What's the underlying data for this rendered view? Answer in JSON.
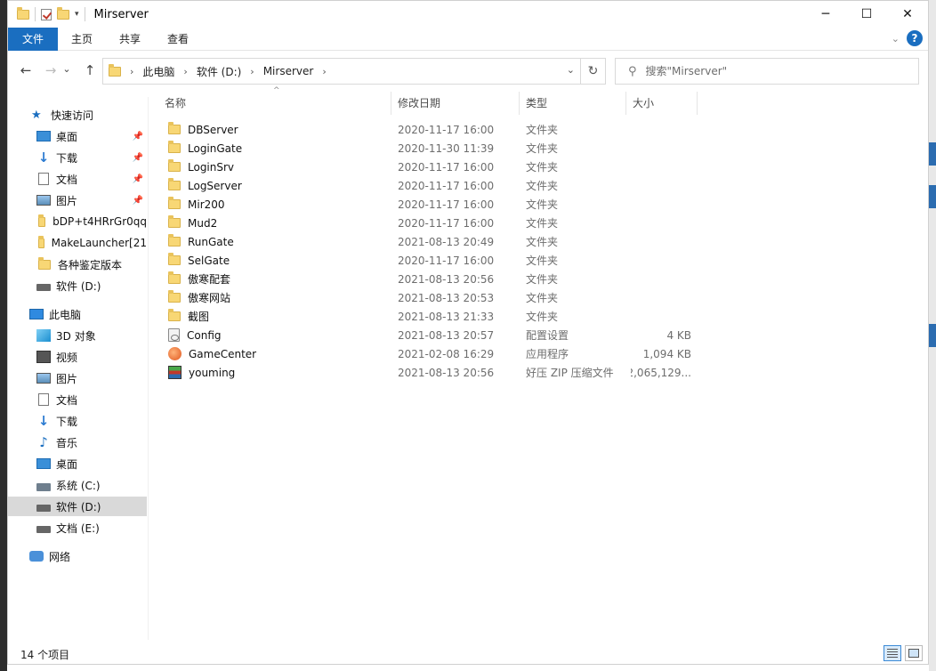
{
  "window": {
    "title": "Mirserver",
    "controls": {
      "minimize": "─",
      "maximize": "☐",
      "close": "✕"
    }
  },
  "ribbon": {
    "tabs": [
      "文件",
      "主页",
      "共享",
      "查看"
    ],
    "help": "?"
  },
  "nav": {
    "back": "←",
    "forward": "→",
    "recent": "⌄",
    "up": "↑",
    "breadcrumb": [
      "此电脑",
      "软件 (D:)",
      "Mirserver"
    ],
    "refresh": "↻",
    "search_placeholder": "搜索\"Mirserver\""
  },
  "sidebar": {
    "items": [
      {
        "label": "快速访问",
        "icon": "star-icon"
      },
      {
        "label": "桌面",
        "icon": "desktop-icon",
        "pinned": true
      },
      {
        "label": "下载",
        "icon": "download-icon",
        "pinned": true
      },
      {
        "label": "文档",
        "icon": "document-icon",
        "pinned": true
      },
      {
        "label": "图片",
        "icon": "picture-icon",
        "pinned": true
      },
      {
        "label": "bDP+t4HRrGr0qq",
        "icon": "folder-icon"
      },
      {
        "label": "MakeLauncher[21",
        "icon": "folder-icon"
      },
      {
        "label": "各种鉴定版本",
        "icon": "folder-icon"
      },
      {
        "label": "软件 (D:)",
        "icon": "drive-icon"
      },
      {
        "label": "此电脑",
        "icon": "computer-icon"
      },
      {
        "label": "3D 对象",
        "icon": "3d-objects-icon"
      },
      {
        "label": "视频",
        "icon": "video-icon"
      },
      {
        "label": "图片",
        "icon": "picture-icon"
      },
      {
        "label": "文档",
        "icon": "document-icon"
      },
      {
        "label": "下载",
        "icon": "download-icon"
      },
      {
        "label": "音乐",
        "icon": "music-icon"
      },
      {
        "label": "桌面",
        "icon": "desktop-icon"
      },
      {
        "label": "系统 (C:)",
        "icon": "system-drive-icon"
      },
      {
        "label": "软件 (D:)",
        "icon": "drive-icon",
        "selected": true
      },
      {
        "label": "文档 (E:)",
        "icon": "drive-icon"
      },
      {
        "label": "网络",
        "icon": "network-icon"
      }
    ]
  },
  "columns": {
    "name": "名称",
    "date": "修改日期",
    "type": "类型",
    "size": "大小"
  },
  "files": [
    {
      "name": "DBServer",
      "date": "2020-11-17 16:00",
      "type": "文件夹",
      "size": "",
      "icon": "folder-icon"
    },
    {
      "name": "LoginGate",
      "date": "2020-11-30 11:39",
      "type": "文件夹",
      "size": "",
      "icon": "folder-icon"
    },
    {
      "name": "LoginSrv",
      "date": "2020-11-17 16:00",
      "type": "文件夹",
      "size": "",
      "icon": "folder-icon"
    },
    {
      "name": "LogServer",
      "date": "2020-11-17 16:00",
      "type": "文件夹",
      "size": "",
      "icon": "folder-icon"
    },
    {
      "name": "Mir200",
      "date": "2020-11-17 16:00",
      "type": "文件夹",
      "size": "",
      "icon": "folder-icon"
    },
    {
      "name": "Mud2",
      "date": "2020-11-17 16:00",
      "type": "文件夹",
      "size": "",
      "icon": "folder-icon"
    },
    {
      "name": "RunGate",
      "date": "2021-08-13 20:49",
      "type": "文件夹",
      "size": "",
      "icon": "folder-icon"
    },
    {
      "name": "SelGate",
      "date": "2020-11-17 16:00",
      "type": "文件夹",
      "size": "",
      "icon": "folder-icon"
    },
    {
      "name": "傲寒配套",
      "date": "2021-08-13 20:56",
      "type": "文件夹",
      "size": "",
      "icon": "folder-icon"
    },
    {
      "name": "傲寒网站",
      "date": "2021-08-13 20:53",
      "type": "文件夹",
      "size": "",
      "icon": "folder-icon"
    },
    {
      "name": "截图",
      "date": "2021-08-13 21:33",
      "type": "文件夹",
      "size": "",
      "icon": "folder-icon"
    },
    {
      "name": "Config",
      "date": "2021-08-13 20:57",
      "type": "配置设置",
      "size": "4 KB",
      "icon": "config-file-icon"
    },
    {
      "name": "GameCenter",
      "date": "2021-02-08 16:29",
      "type": "应用程序",
      "size": "1,094 KB",
      "icon": "application-icon"
    },
    {
      "name": "youming",
      "date": "2021-08-13 20:56",
      "type": "好压 ZIP 压缩文件",
      "size": "2,065,129...",
      "icon": "zip-archive-icon"
    }
  ],
  "status": {
    "item_count": "14 个项目"
  }
}
